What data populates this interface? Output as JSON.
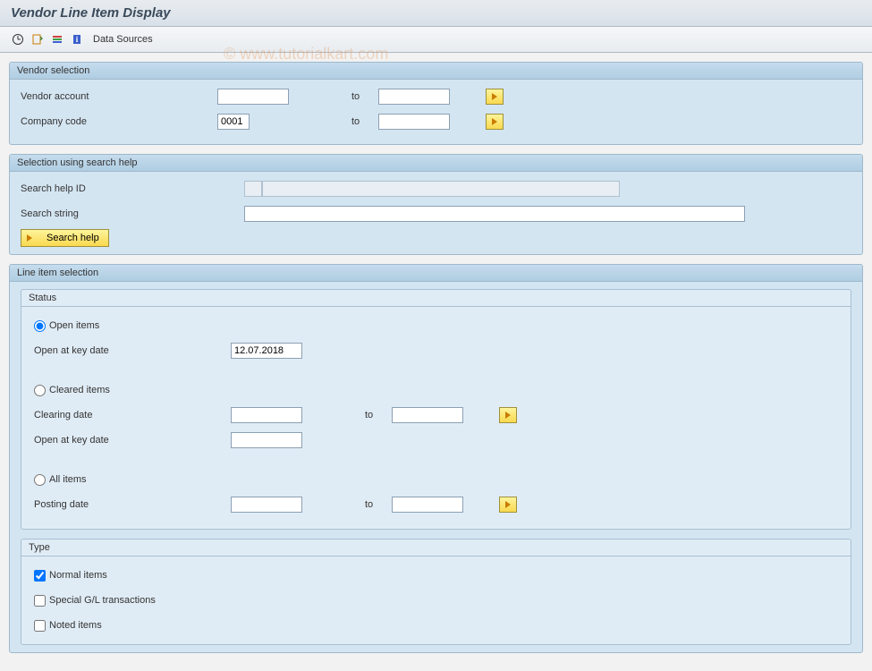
{
  "title": "Vendor Line Item Display",
  "toolbar": {
    "data_sources": "Data Sources"
  },
  "vendor_selection": {
    "title": "Vendor selection",
    "vendor_account_label": "Vendor account",
    "vendor_account_from": "",
    "vendor_account_to": "",
    "company_code_label": "Company code",
    "company_code_from": "0001",
    "company_code_to": "",
    "to_label": "to"
  },
  "search_help": {
    "title": "Selection using search help",
    "search_help_id_label": "Search help ID",
    "search_help_id_value": "",
    "search_string_label": "Search string",
    "search_string_value": "",
    "button_label": "Search help"
  },
  "line_item_selection": {
    "title": "Line item selection",
    "status": {
      "title": "Status",
      "open_items_label": "Open items",
      "open_at_key_date_label": "Open at key date",
      "open_at_key_date_value": "12.07.2018",
      "cleared_items_label": "Cleared items",
      "clearing_date_label": "Clearing date",
      "clearing_date_from": "",
      "clearing_date_to": "",
      "open_at_key_date2_label": "Open at key date",
      "open_at_key_date2_value": "",
      "all_items_label": "All items",
      "posting_date_label": "Posting date",
      "posting_date_from": "",
      "posting_date_to": "",
      "to_label": "to"
    },
    "type": {
      "title": "Type",
      "normal_items_label": "Normal items",
      "special_gl_label": "Special G/L transactions",
      "noted_items_label": "Noted items"
    }
  },
  "watermark": "© www.tutorialkart.com"
}
